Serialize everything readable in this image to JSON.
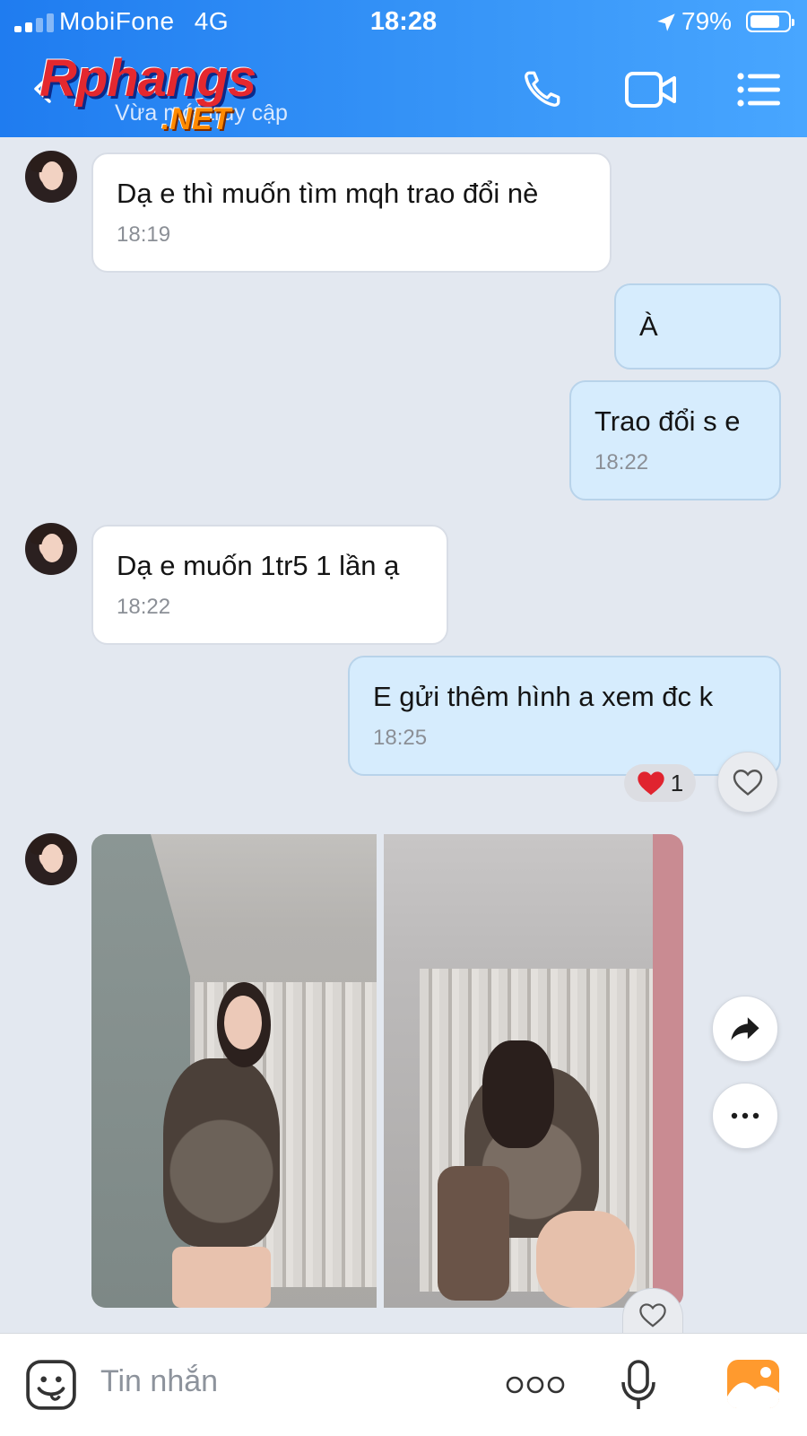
{
  "status_bar": {
    "carrier": "MobiFone",
    "network": "4G",
    "time": "18:28",
    "battery": "79%"
  },
  "header": {
    "watermark_top": "Rphangs",
    "watermark_bottom": ".NET",
    "subtitle": "Vừa mới truy cập",
    "icons": [
      "back-chevron-icon",
      "phone-icon",
      "video-call-icon",
      "menu-list-icon"
    ]
  },
  "messages": [
    {
      "side": "in",
      "text": "Dạ e thì muốn tìm mqh trao đổi nè",
      "time": "18:19"
    },
    {
      "side": "out",
      "text": "À",
      "time": ""
    },
    {
      "side": "out",
      "text": "Trao đổi s e",
      "time": "18:22"
    },
    {
      "side": "in",
      "text": "Dạ e muốn 1tr5 1 lần ạ",
      "time": "18:22"
    },
    {
      "side": "out",
      "text": "E gửi thêm hình a xem đc k",
      "time": "18:25"
    }
  ],
  "reaction": {
    "emoji": "❤️",
    "count": "1"
  },
  "photo_message": {
    "images": 2,
    "actions": [
      "share-icon",
      "more-icon",
      "heart-icon"
    ]
  },
  "composer": {
    "placeholder": "Tin nhắn",
    "icons": [
      "sticker-icon",
      "more-options-icon",
      "microphone-icon",
      "gallery-icon"
    ]
  },
  "colors": {
    "header_blue": "#2f8cf5",
    "outgoing_bubble": "#d6ecfd",
    "incoming_bubble": "#ffffff",
    "chat_background": "#e3e8f0",
    "gallery_orange": "#ff9a2e"
  }
}
